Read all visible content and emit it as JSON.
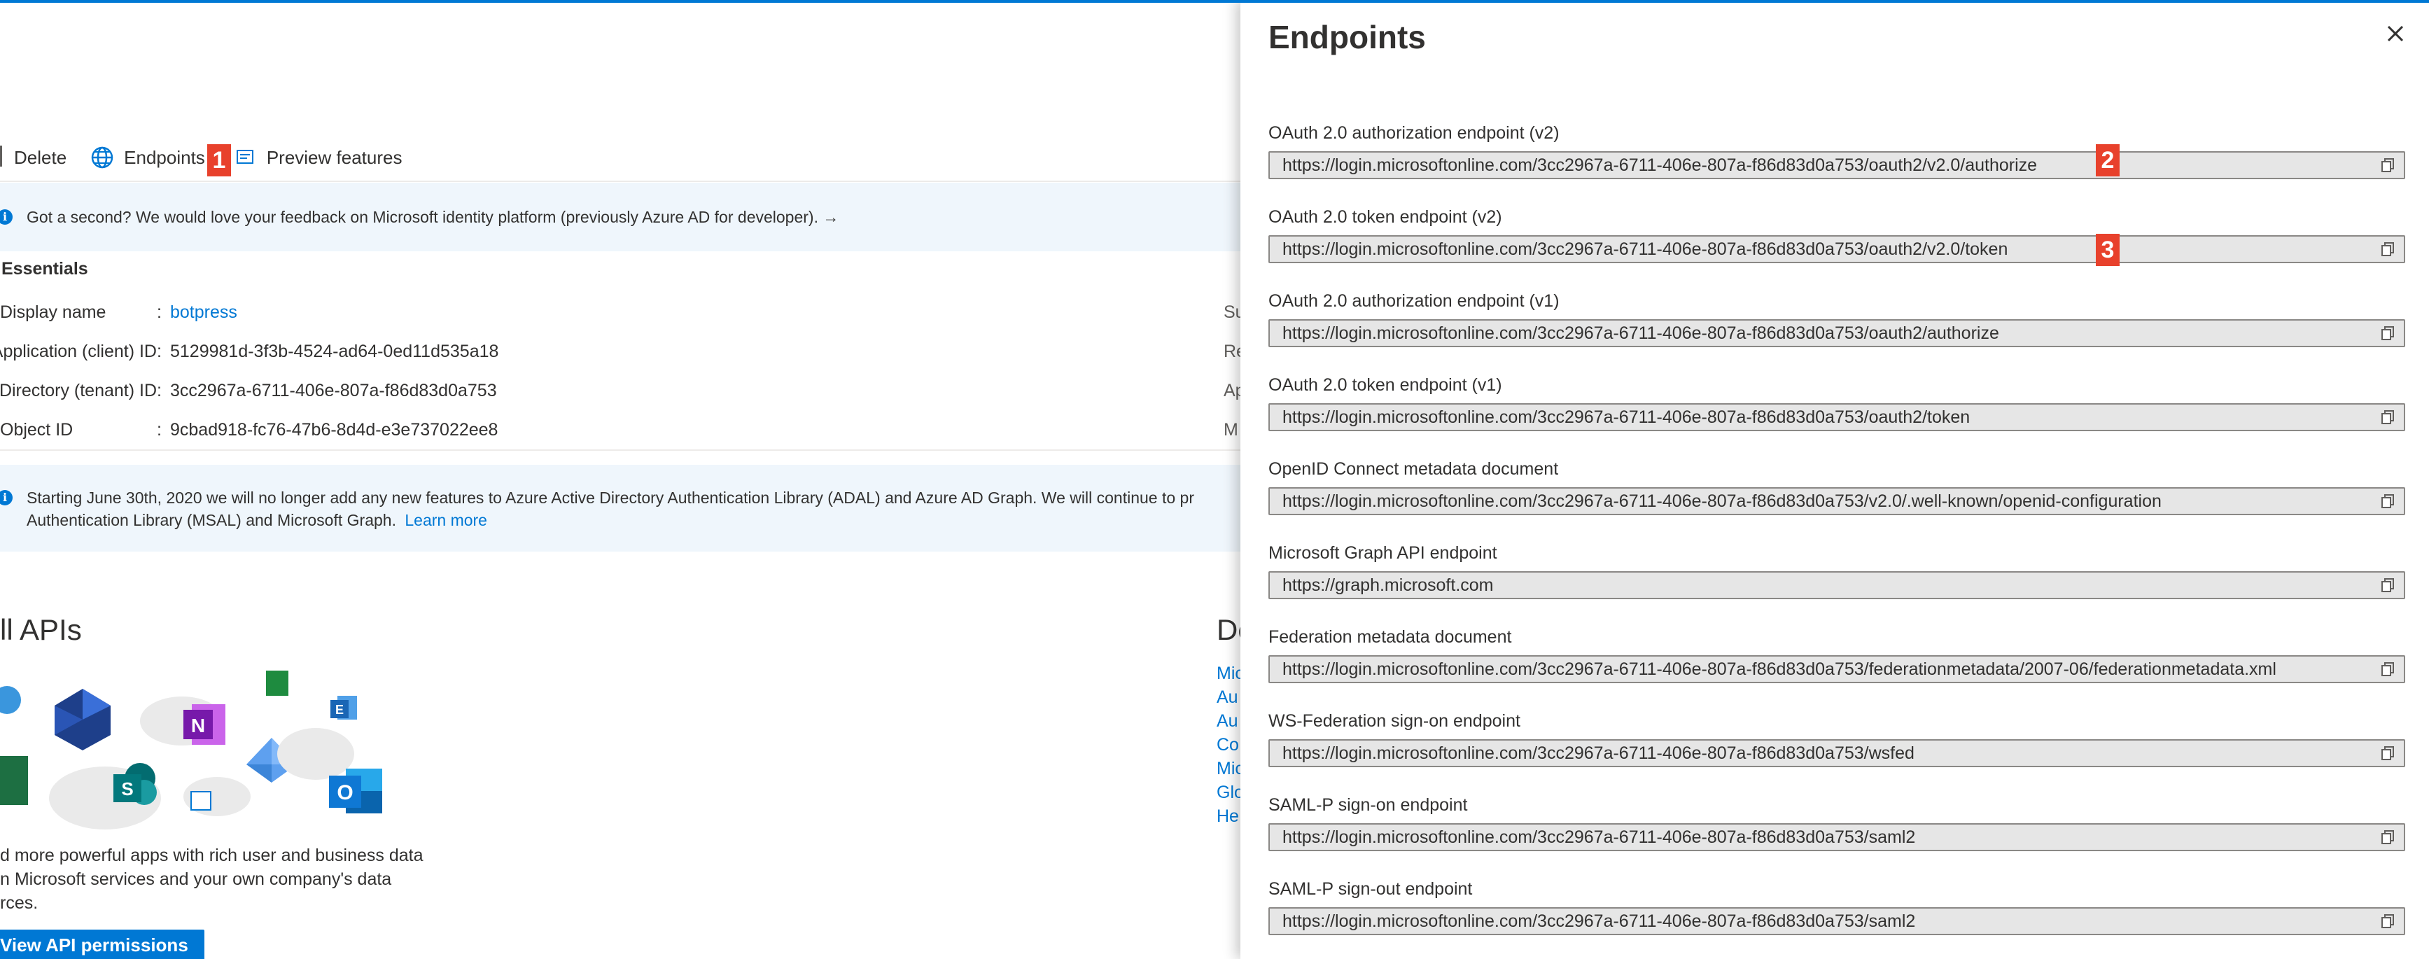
{
  "toolbar": {
    "delete_label": "Delete",
    "endpoints_label": "Endpoints",
    "preview_label": "Preview features"
  },
  "feedback_banner": {
    "text": "Got a second? We would love your feedback on Microsoft identity platform (previously Azure AD for developer). →"
  },
  "essentials": {
    "title": "Essentials",
    "rows": [
      {
        "label": "Display name",
        "value": "botpress",
        "is_link": true
      },
      {
        "label": "Application (client) ID",
        "value": "5129981d-3f3b-4524-ad64-0ed11d535a18"
      },
      {
        "label": "Directory (tenant) ID",
        "value": "3cc2967a-6711-406e-807a-f86d83d0a753"
      },
      {
        "label": "Object ID",
        "value": "9cbad918-fc76-47b6-8d4d-e3e737022ee8"
      }
    ],
    "right_labels": [
      "Su",
      "Re",
      "Ap",
      "M"
    ]
  },
  "adal_banner": {
    "line1": "Starting June 30th, 2020 we will no longer add any new features to Azure Active Directory Authentication Library (ADAL) and Azure AD Graph. We will continue to pr",
    "line2": "Authentication Library (MSAL) and Microsoft Graph.",
    "link": "Learn more"
  },
  "apis_section": {
    "heading": "ll APIs",
    "text_lines": [
      "d more powerful apps with rich user and business data",
      "n Microsoft services and your own company's data",
      "rces."
    ],
    "button_label": "View API permissions"
  },
  "docs_section": {
    "heading": "De",
    "links": [
      "Mic",
      "Au",
      "Au",
      "Co",
      "Mic",
      "Glo",
      "He"
    ]
  },
  "panel": {
    "title": "Endpoints",
    "endpoints": [
      {
        "label": "OAuth 2.0 authorization endpoint (v2)",
        "value": "https://login.microsoftonline.com/3cc2967a-6711-406e-807a-f86d83d0a753/oauth2/v2.0/authorize"
      },
      {
        "label": "OAuth 2.0 token endpoint (v2)",
        "value": "https://login.microsoftonline.com/3cc2967a-6711-406e-807a-f86d83d0a753/oauth2/v2.0/token"
      },
      {
        "label": "OAuth 2.0 authorization endpoint (v1)",
        "value": "https://login.microsoftonline.com/3cc2967a-6711-406e-807a-f86d83d0a753/oauth2/authorize"
      },
      {
        "label": "OAuth 2.0 token endpoint (v1)",
        "value": "https://login.microsoftonline.com/3cc2967a-6711-406e-807a-f86d83d0a753/oauth2/token"
      },
      {
        "label": "OpenID Connect metadata document",
        "value": "https://login.microsoftonline.com/3cc2967a-6711-406e-807a-f86d83d0a753/v2.0/.well-known/openid-configuration"
      },
      {
        "label": "Microsoft Graph API endpoint",
        "value": "https://graph.microsoft.com"
      },
      {
        "label": "Federation metadata document",
        "value": "https://login.microsoftonline.com/3cc2967a-6711-406e-807a-f86d83d0a753/federationmetadata/2007-06/federationmetadata.xml"
      },
      {
        "label": "WS-Federation sign-on endpoint",
        "value": "https://login.microsoftonline.com/3cc2967a-6711-406e-807a-f86d83d0a753/wsfed"
      },
      {
        "label": "SAML-P sign-on endpoint",
        "value": "https://login.microsoftonline.com/3cc2967a-6711-406e-807a-f86d83d0a753/saml2"
      },
      {
        "label": "SAML-P sign-out endpoint",
        "value": "https://login.microsoftonline.com/3cc2967a-6711-406e-807a-f86d83d0a753/saml2"
      }
    ]
  },
  "annotations": [
    "1",
    "2",
    "3"
  ],
  "colors": {
    "accent": "#0078d4",
    "annotation": "#e8412c",
    "banner_bg": "#eff6fc",
    "field_bg": "#e6e6e6"
  }
}
